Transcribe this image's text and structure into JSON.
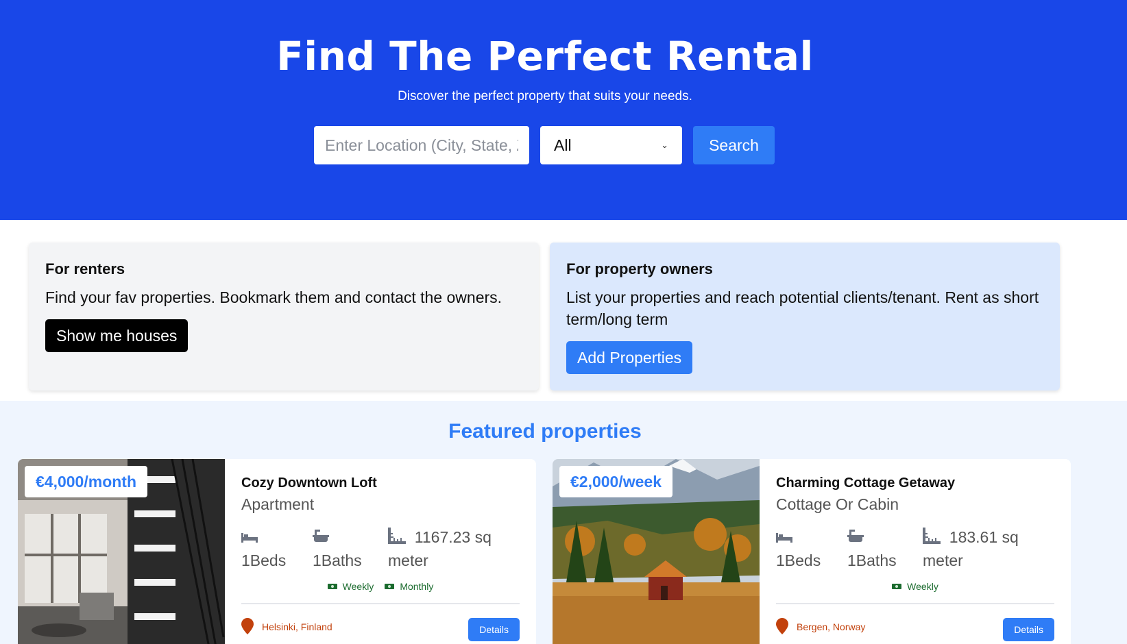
{
  "hero": {
    "title": "Find The Perfect Rental",
    "subtitle": "Discover the perfect property that suits your needs.",
    "search_placeholder": "Enter Location (City, State, Zip, etc",
    "type_selected": "All",
    "search_label": "Search"
  },
  "renters": {
    "title": "For renters",
    "text": "Find your fav properties. Bookmark them and contact the owners.",
    "button": "Show me houses"
  },
  "owners": {
    "title": "For property owners",
    "text": "List your properties and reach potential clients/tenant. Rent as short term/long term",
    "button": "Add Properties"
  },
  "featured": {
    "title": "Featured properties",
    "properties": [
      {
        "price": "€4,000/month",
        "name": "Cozy Downtown Loft",
        "type": "Apartment",
        "beds": "1Beds",
        "baths": "1Baths",
        "area": "1167.23 sq meter",
        "rates": [
          "Weekly",
          "Monthly"
        ],
        "location": "Helsinki, Finland",
        "details_label": "Details",
        "image_icon": "loft-interior-image"
      },
      {
        "price": "€2,000/week",
        "name": "Charming Cottage Getaway",
        "type": "Cottage Or Cabin",
        "beds": "1Beds",
        "baths": "1Baths",
        "area": "183.61 sq meter",
        "rates": [
          "Weekly"
        ],
        "location": "Bergen, Norway",
        "details_label": "Details",
        "image_icon": "cabin-landscape-image"
      }
    ]
  },
  "colors": {
    "hero_bg": "#1947e8",
    "accent": "#2f7cf6",
    "owners_bg": "#dbe8fd",
    "location": "#c2410c",
    "rate": "#1b6b2e"
  }
}
